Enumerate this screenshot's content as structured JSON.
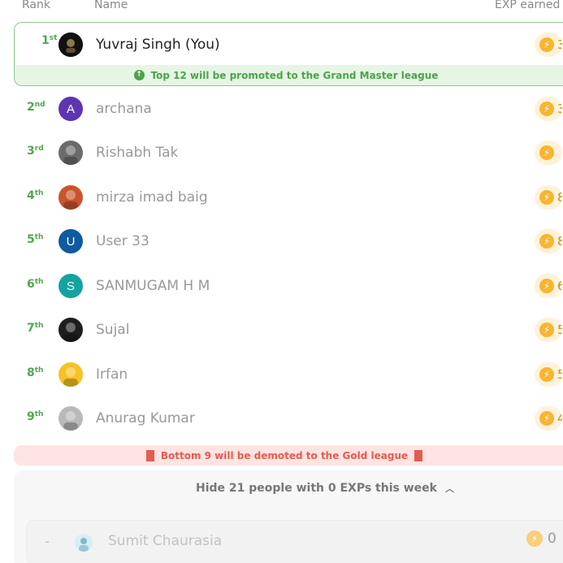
{
  "header": {
    "rank_label": "Rank",
    "name_label": "Name",
    "exp_label": "EXP earned"
  },
  "me": {
    "rank_num": "1",
    "rank_suffix": "st",
    "name": "Yuvraj Singh (You)",
    "xp_visible": "3"
  },
  "promotion_banner": {
    "text": "Top 12 will be promoted to the Grand Master league",
    "icon": "arrow-up-circle-icon"
  },
  "rows": [
    {
      "rank_num": "2",
      "rank_suffix": "nd",
      "name": "archana",
      "initial": "A",
      "avatar_color": "#5e35b1",
      "xp_visible": "3"
    },
    {
      "rank_num": "3",
      "rank_suffix": "rd",
      "name": "Rishabh Tak",
      "initial": "",
      "avatar_color": "#6b6b6b",
      "xp_visible": ""
    },
    {
      "rank_num": "4",
      "rank_suffix": "th",
      "name": "mirza imad baig",
      "initial": "",
      "avatar_color": "#c8552b",
      "xp_visible": "8"
    },
    {
      "rank_num": "5",
      "rank_suffix": "th",
      "name": "User 33",
      "initial": "U",
      "avatar_color": "#0f5aa0",
      "xp_visible": "8"
    },
    {
      "rank_num": "6",
      "rank_suffix": "th",
      "name": "SANMUGAM H M",
      "initial": "S",
      "avatar_color": "#14a3a0",
      "xp_visible": "6"
    },
    {
      "rank_num": "7",
      "rank_suffix": "th",
      "name": "Sujal",
      "initial": "",
      "avatar_color": "#1e1e1e",
      "xp_visible": "5"
    },
    {
      "rank_num": "8",
      "rank_suffix": "th",
      "name": "Irfan",
      "initial": "",
      "avatar_color": "#f6c325",
      "xp_visible": "5"
    },
    {
      "rank_num": "9",
      "rank_suffix": "th",
      "name": "Anurag Kumar",
      "initial": "",
      "avatar_color": "#b9b9b9",
      "xp_visible": "4"
    }
  ],
  "demotion_banner": {
    "text": "Bottom 9 will be demoted to the Gold league",
    "icon": "arrow-down-circle-icon"
  },
  "hidden_toggle": {
    "text": "Hide 21 people with 0 EXPs this week",
    "icon": "chevron-up-icon"
  },
  "zero_row": {
    "rank": "-",
    "name": "Sumit Chaurasia",
    "xp": "0"
  },
  "colors": {
    "accent_green": "#4aa44a",
    "demote_red": "#e45b52",
    "xp_gold": "#f7b531"
  }
}
